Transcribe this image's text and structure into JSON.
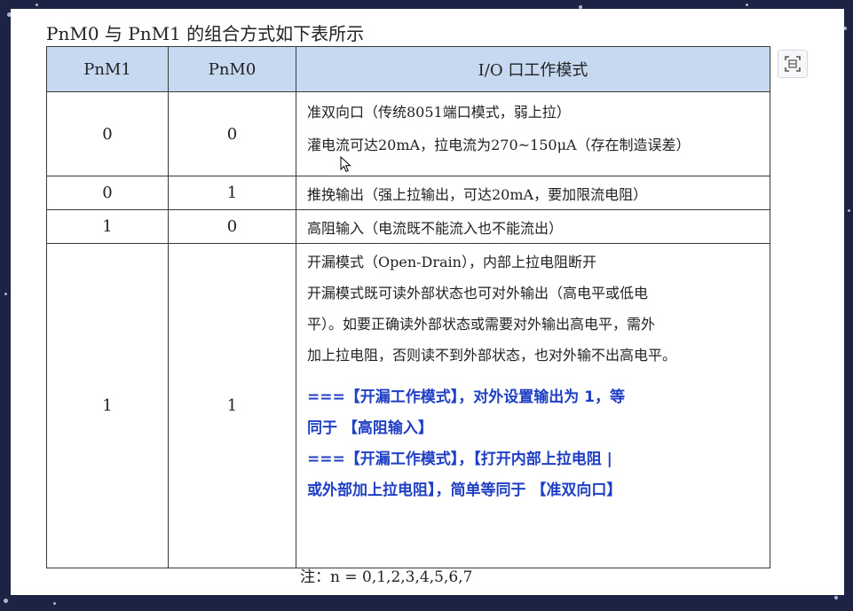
{
  "caption": "PnM0 与 PnM1 的组合方式如下表所示",
  "table": {
    "headers": [
      "PnM1",
      "PnM0",
      "I/O 口工作模式"
    ],
    "rows": [
      {
        "pnm1": "0",
        "pnm0": "0",
        "lines": [
          "准双向口（传统8051端口模式，弱上拉）",
          "灌电流可达20mA，拉电流为270~150μA（存在制造误差）"
        ]
      },
      {
        "pnm1": "0",
        "pnm0": "1",
        "lines": [
          "推挽输出（强上拉输出，可达20mA，要加限流电阻）"
        ]
      },
      {
        "pnm1": "1",
        "pnm0": "0",
        "lines": [
          "高阻输入（电流既不能流入也不能流出）"
        ]
      },
      {
        "pnm1": "1",
        "pnm0": "1",
        "lines": [
          "开漏模式（Open-Drain），内部上拉电阻断开",
          "开漏模式既可读外部状态也可对外输出（高电平或低电",
          "平）。如要正确读外部状态或需要对外输出高电平，需外",
          "加上拉电阻，否则读不到外部状态，也对外输不出高电平。"
        ],
        "notes": [
          "===【开漏工作模式】，对外设置输出为 1，等",
          "同于 【高阻输入】",
          "===【开漏工作模式】，【打开内部上拉电阻 |",
          "或外部加上拉电阻】，简单等同于 【准双向口】"
        ]
      }
    ]
  },
  "footnote": "注：n = 0,1,2,3,4,5,6,7",
  "colors": {
    "header_bg": "#c6d9f1",
    "note_text": "#1f3fc4",
    "background": "#1b2444"
  },
  "icons": {
    "toolbar": "screenshot-crop-icon",
    "pointer": "mouse-cursor-icon"
  }
}
